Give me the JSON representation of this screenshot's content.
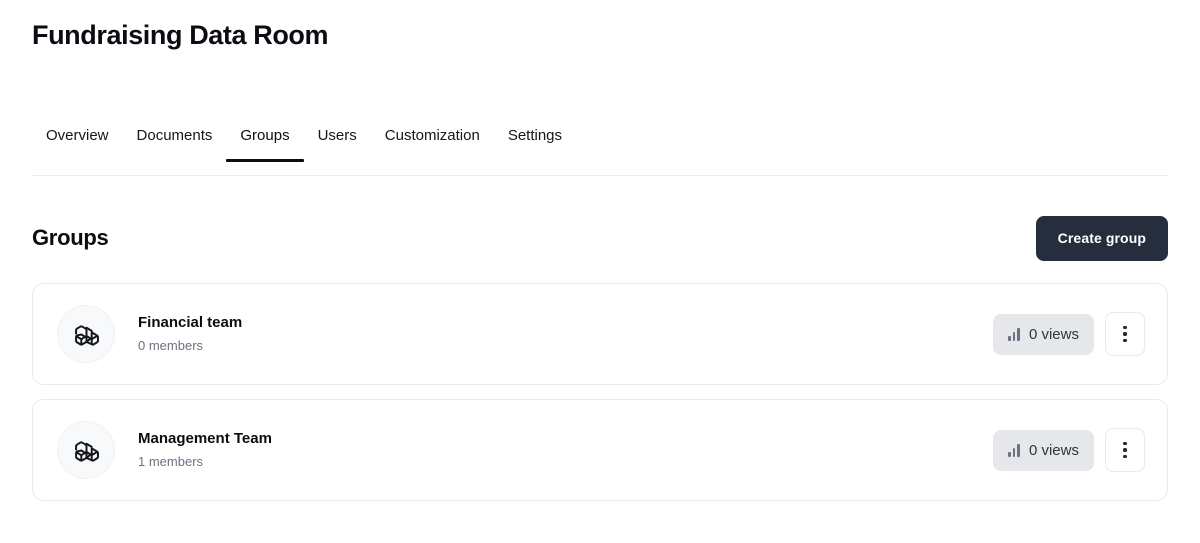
{
  "header": {
    "title": "Fundraising Data Room"
  },
  "tabs": [
    {
      "label": "Overview",
      "active": false,
      "name": "tab-overview"
    },
    {
      "label": "Documents",
      "active": false,
      "name": "tab-documents"
    },
    {
      "label": "Groups",
      "active": true,
      "name": "tab-groups"
    },
    {
      "label": "Users",
      "active": false,
      "name": "tab-users"
    },
    {
      "label": "Customization",
      "active": false,
      "name": "tab-customization"
    },
    {
      "label": "Settings",
      "active": false,
      "name": "tab-settings"
    }
  ],
  "section": {
    "title": "Groups",
    "create_button_label": "Create group"
  },
  "groups": [
    {
      "name": "Financial team",
      "members": "0 members",
      "views": "0 views",
      "avatar_icon": "boxes-icon",
      "views_icon": "bar-chart-icon",
      "menu_icon": "more-vertical-icon"
    },
    {
      "name": "Management Team",
      "members": "1 members",
      "views": "0 views",
      "avatar_icon": "boxes-icon",
      "views_icon": "bar-chart-icon",
      "menu_icon": "more-vertical-icon"
    }
  ],
  "colors": {
    "primary_button_bg": "#262d3d",
    "badge_bg": "#e5e7eb",
    "card_border": "#e8e9ec",
    "muted_text": "#6b7280",
    "active_tab_underline": "#0b0d12"
  }
}
